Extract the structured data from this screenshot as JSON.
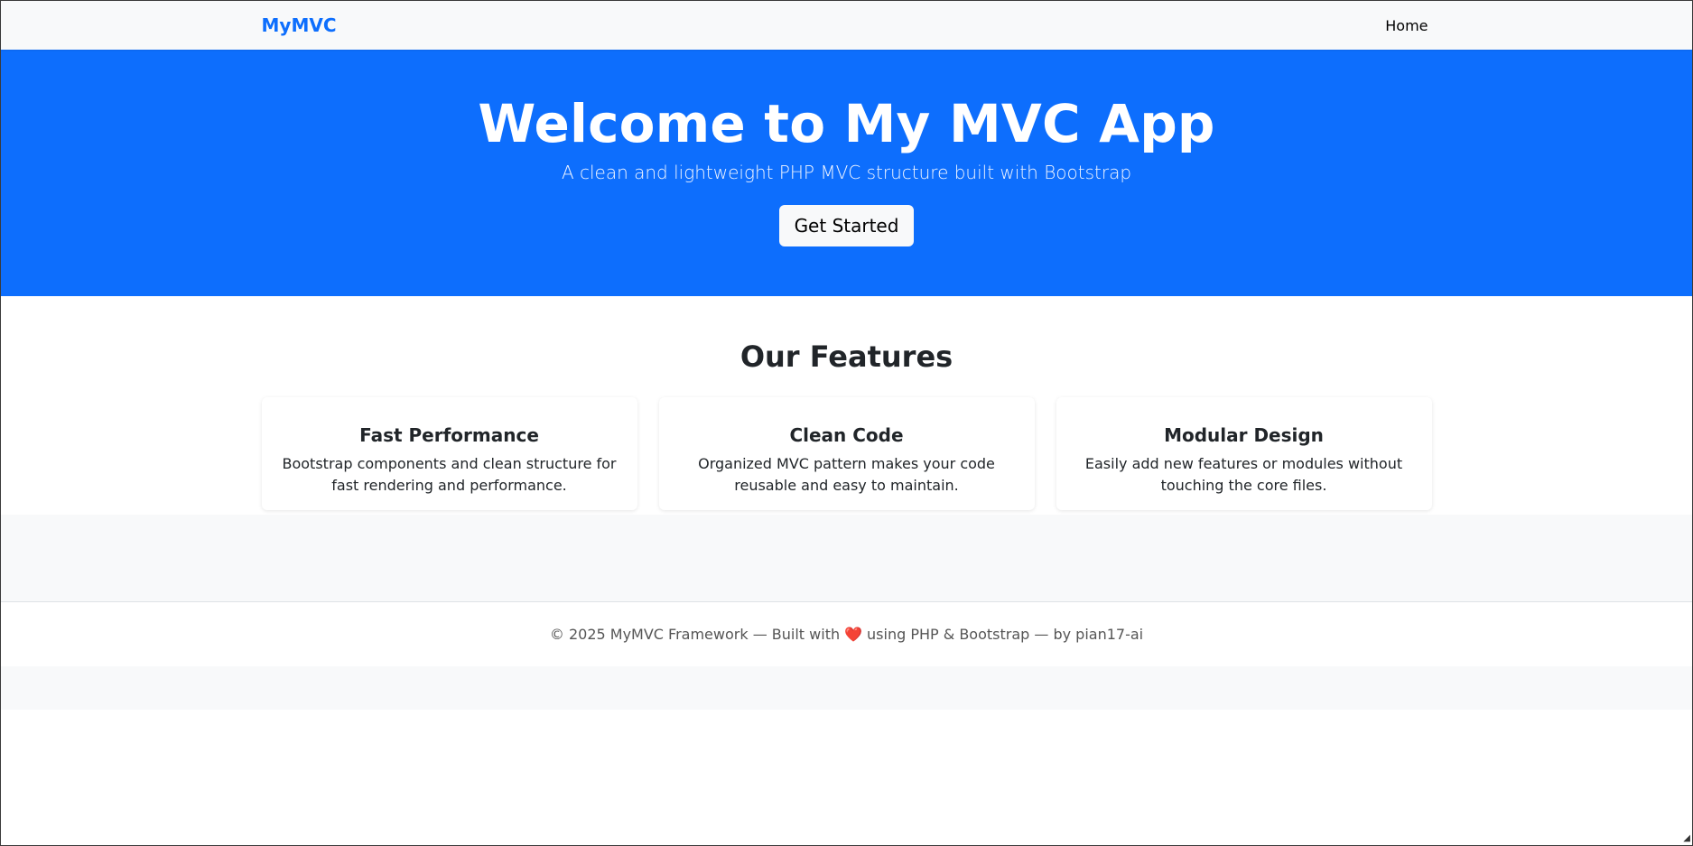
{
  "navbar": {
    "brand": "MyMVC",
    "links": [
      {
        "label": "Home"
      }
    ]
  },
  "hero": {
    "title": "Welcome to My MVC App",
    "subtitle": "A clean and lightweight PHP MVC structure built with Bootstrap",
    "cta_label": "Get Started"
  },
  "features": {
    "heading": "Our Features",
    "cards": [
      {
        "title": "Fast Performance",
        "text": "Bootstrap components and clean structure for fast rendering and performance."
      },
      {
        "title": "Clean Code",
        "text": "Organized MVC pattern makes your code reusable and easy to maintain."
      },
      {
        "title": "Modular Design",
        "text": "Easily add new features or modules without touching the core files."
      }
    ]
  },
  "footer": {
    "text_before": "© 2025 MyMVC Framework — Built with",
    "heart": "❤️",
    "text_after": "using PHP & Bootstrap — by pian17-ai"
  },
  "colors": {
    "primary": "#0d6efd",
    "navbar_bg": "#f8f9fa",
    "heart": "#e74c4c"
  },
  "icons": {
    "heart": "heart-icon"
  }
}
